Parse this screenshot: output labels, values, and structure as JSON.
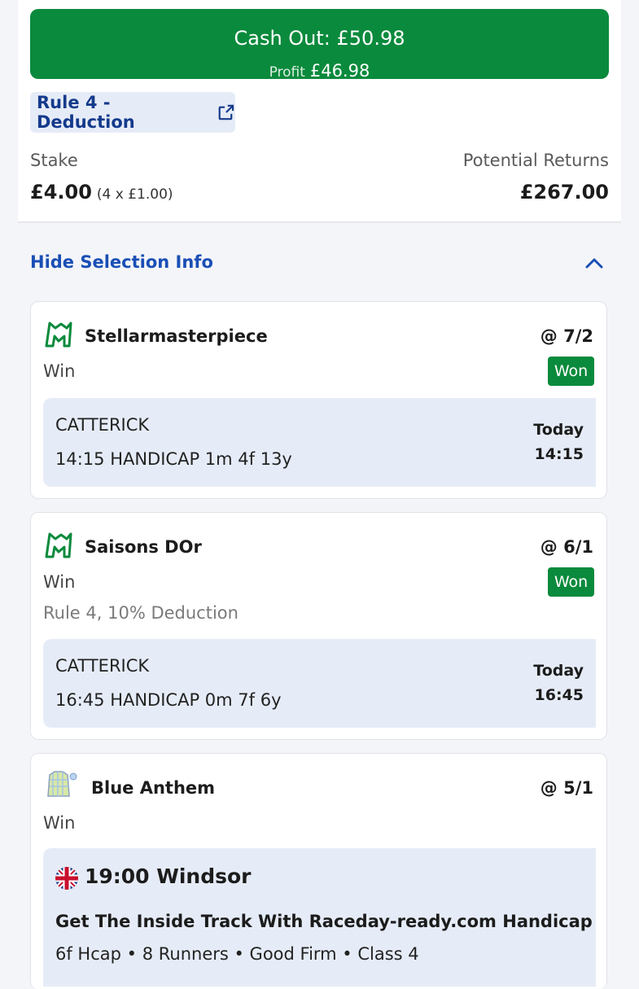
{
  "cashout": {
    "label": "Cash Out: £50.98",
    "profit_label": "Profit",
    "profit_value": "£46.98"
  },
  "rule4_link": {
    "label": "Rule 4 - Deduction",
    "icon": "external-link-icon"
  },
  "stake": {
    "label": "Stake",
    "value": "£4.00",
    "breakdown": "(4 x £1.00)"
  },
  "returns": {
    "label": "Potential Returns",
    "value": "£267.00"
  },
  "selection_info": {
    "toggle_label": "Hide Selection Info",
    "icon": "chevron-up-icon"
  },
  "selections": [
    {
      "name": "Stellarmasterpiece",
      "odds": "@ 7/2",
      "market": "Win",
      "result": "Won",
      "course": "CATTERICK",
      "race": "14:15 HANDICAP 1m 4f 13y",
      "day": "Today",
      "time": "14:15"
    },
    {
      "name": "Saisons DOr",
      "odds": "@ 6/1",
      "market": "Win",
      "result": "Won",
      "note": "Rule 4, 10% Deduction",
      "course": "CATTERICK",
      "race": "16:45 HANDICAP 0m 7f 6y",
      "day": "Today",
      "time": "16:45"
    },
    {
      "name": "Blue Anthem",
      "odds": "@ 5/1",
      "market": "Win",
      "race_title": "19:00 Windsor",
      "race_name": "Get The Inside Track With Raceday-ready.com Handicap",
      "race_details": "6f Hcap • 8 Runners • Good Firm • Class 4"
    }
  ],
  "colors": {
    "green": "#0a8a3c",
    "blue": "#1a4fb5",
    "navy": "#143a8c",
    "panel": "#e6ecf7"
  }
}
